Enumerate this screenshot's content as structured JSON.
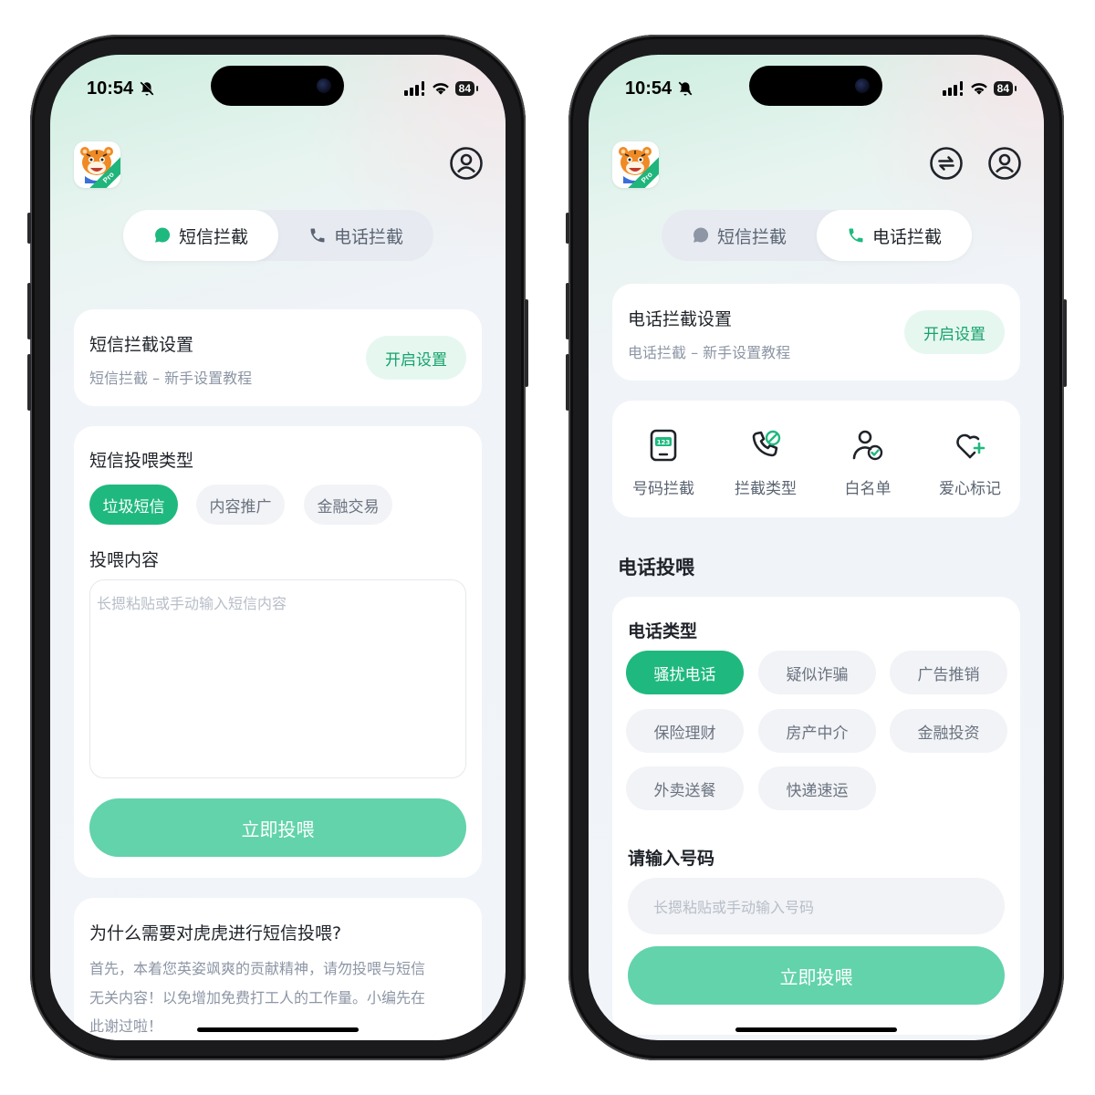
{
  "status_bar": {
    "time": "10:54",
    "battery": "84"
  },
  "left": {
    "tabs": [
      {
        "label": "短信拦截",
        "active": true
      },
      {
        "label": "电话拦截",
        "active": false
      }
    ],
    "settings_card": {
      "title": "短信拦截设置",
      "subtitle": "短信拦截 – 新手设置教程",
      "button": "开启设置"
    },
    "feed_card": {
      "type_title": "短信投喂类型",
      "types": [
        {
          "label": "垃圾短信",
          "active": true
        },
        {
          "label": "内容推广",
          "active": false
        },
        {
          "label": "金融交易",
          "active": false
        }
      ],
      "content_title": "投喂内容",
      "placeholder": "长摁粘贴或手动输入短信内容",
      "submit": "立即投喂"
    },
    "faq_card": {
      "title": "为什么需要对虎虎进行短信投喂?",
      "lines": [
        "首先，本着您英姿飒爽的贡献精神，请勿投喂与短信",
        "无关内容！以免增加免费打工人的工作量。小编先在",
        "此谢过啦！"
      ]
    }
  },
  "right": {
    "tabs": [
      {
        "label": "短信拦截",
        "active": false
      },
      {
        "label": "电话拦截",
        "active": true
      }
    ],
    "settings_card": {
      "title": "电话拦截设置",
      "subtitle": "电话拦截 – 新手设置教程",
      "button": "开启设置"
    },
    "features": [
      {
        "label": "号码拦截",
        "icon": "number-keypad-icon"
      },
      {
        "label": "拦截类型",
        "icon": "phone-block-icon"
      },
      {
        "label": "白名单",
        "icon": "user-check-icon"
      },
      {
        "label": "爱心标记",
        "icon": "heart-plus-icon"
      }
    ],
    "section_title": "电话投喂",
    "feed_card": {
      "type_title": "电话类型",
      "types": [
        {
          "label": "骚扰电话",
          "active": true
        },
        {
          "label": "疑似诈骗",
          "active": false
        },
        {
          "label": "广告推销",
          "active": false
        },
        {
          "label": "保险理财",
          "active": false
        },
        {
          "label": "房产中介",
          "active": false
        },
        {
          "label": "金融投资",
          "active": false
        },
        {
          "label": "外卖送餐",
          "active": false
        },
        {
          "label": "快递速运",
          "active": false
        }
      ],
      "number_title": "请输入号码",
      "placeholder": "长摁粘贴或手动输入号码",
      "submit": "立即投喂"
    }
  },
  "colors": {
    "accent": "#1fb97f",
    "submit": "#62d3ab",
    "pill_bg": "#e6f7f0",
    "pill_text": "#16a36c"
  }
}
